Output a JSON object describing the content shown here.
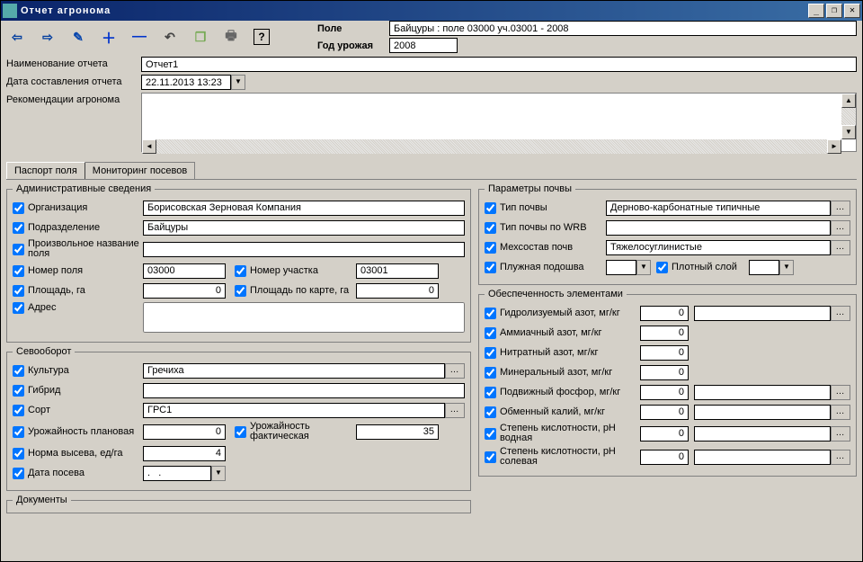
{
  "window": {
    "title": "Отчет агронома",
    "min": "_",
    "restore": "❐",
    "close": "✕"
  },
  "header": {
    "field_label": "Поле",
    "field_value": "Байцуры : поле 03000 уч.03001 - 2008",
    "year_label": "Год урожая",
    "year_value": "2008"
  },
  "top": {
    "name_label": "Наименование отчета",
    "name_value": "Отчет1",
    "date_label": "Дата составления отчета",
    "date_value": "22.11.2013 13:23",
    "rec_label": "Рекомендации агронома",
    "rec_value": ""
  },
  "tabs": {
    "t1": "Паспорт поля",
    "t2": "Мониторинг посевов"
  },
  "admin": {
    "legend": "Административные сведения",
    "org_l": "Организация",
    "org_v": "Борисовская Зерновая Компания",
    "sub_l": "Подразделение",
    "sub_v": "Байцуры",
    "arb_l": "Произвольное название поля",
    "arb_v": "",
    "fnum_l": "Номер поля",
    "fnum_v": "03000",
    "pnum_l": "Номер участка",
    "pnum_v": "03001",
    "area_l": "Площадь, га",
    "area_v": "0",
    "maparea_l": "Площадь по карте, га",
    "maparea_v": "0",
    "addr_l": "Адрес",
    "addr_v": ""
  },
  "rot": {
    "legend": "Севооборот",
    "cult_l": "Культура",
    "cult_v": "Гречиха",
    "hyb_l": "Гибрид",
    "hyb_v": "",
    "sort_l": "Сорт",
    "sort_v": "ГРС1",
    "yplan_l": "Урожайность плановая",
    "yplan_v": "0",
    "yfact_l": "Урожайность фактическая",
    "yfact_v": "35",
    "seed_l": "Норма высева, ед/га",
    "seed_v": "4",
    "sdate_l": "Дата посева",
    "sdate_v": ".   ."
  },
  "docs": {
    "legend": "Документы"
  },
  "soil": {
    "legend": "Параметры почвы",
    "type_l": "Тип почвы",
    "type_v": "Дерново-карбонатные типичные",
    "wrb_l": "Тип почвы по WRB",
    "wrb_v": "",
    "mech_l": "Мехсостав почв",
    "mech_v": "Тяжелосуглинистые",
    "plough_l": "Плужная подошва",
    "plough_v": "",
    "dense_l": "Плотный слой",
    "dense_v": ""
  },
  "elem": {
    "legend": "Обеспеченность элементами",
    "r1_l": "Гидролизуемый азот, мг/кг",
    "r1_v": "0",
    "r2_l": "Аммиачный азот, мг/кг",
    "r2_v": "0",
    "r3_l": "Нитратный азот, мг/кг",
    "r3_v": "0",
    "r4_l": "Минеральный азот, мг/кг",
    "r4_v": "0",
    "r5_l": "Подвижный фосфор, мг/кг",
    "r5_v": "0",
    "r6_l": "Обменный калий, мг/кг",
    "r6_v": "0",
    "r7_l": "Степень кислотности, pH водная",
    "r7_v": "0",
    "r8_l": "Степень кислотности, pH солевая",
    "r8_v": "0"
  },
  "glyphs": {
    "back": "⇦",
    "fwd": "⇨",
    "edit": "✎",
    "plus": "＋",
    "minus": "—",
    "undo": "↶",
    "copy": "❐",
    "print": "🖶",
    "help": "?",
    "dd": "▼",
    "up": "▲",
    "dn": "▼",
    "lt": "◄",
    "rt": "►",
    "dots": "…"
  }
}
